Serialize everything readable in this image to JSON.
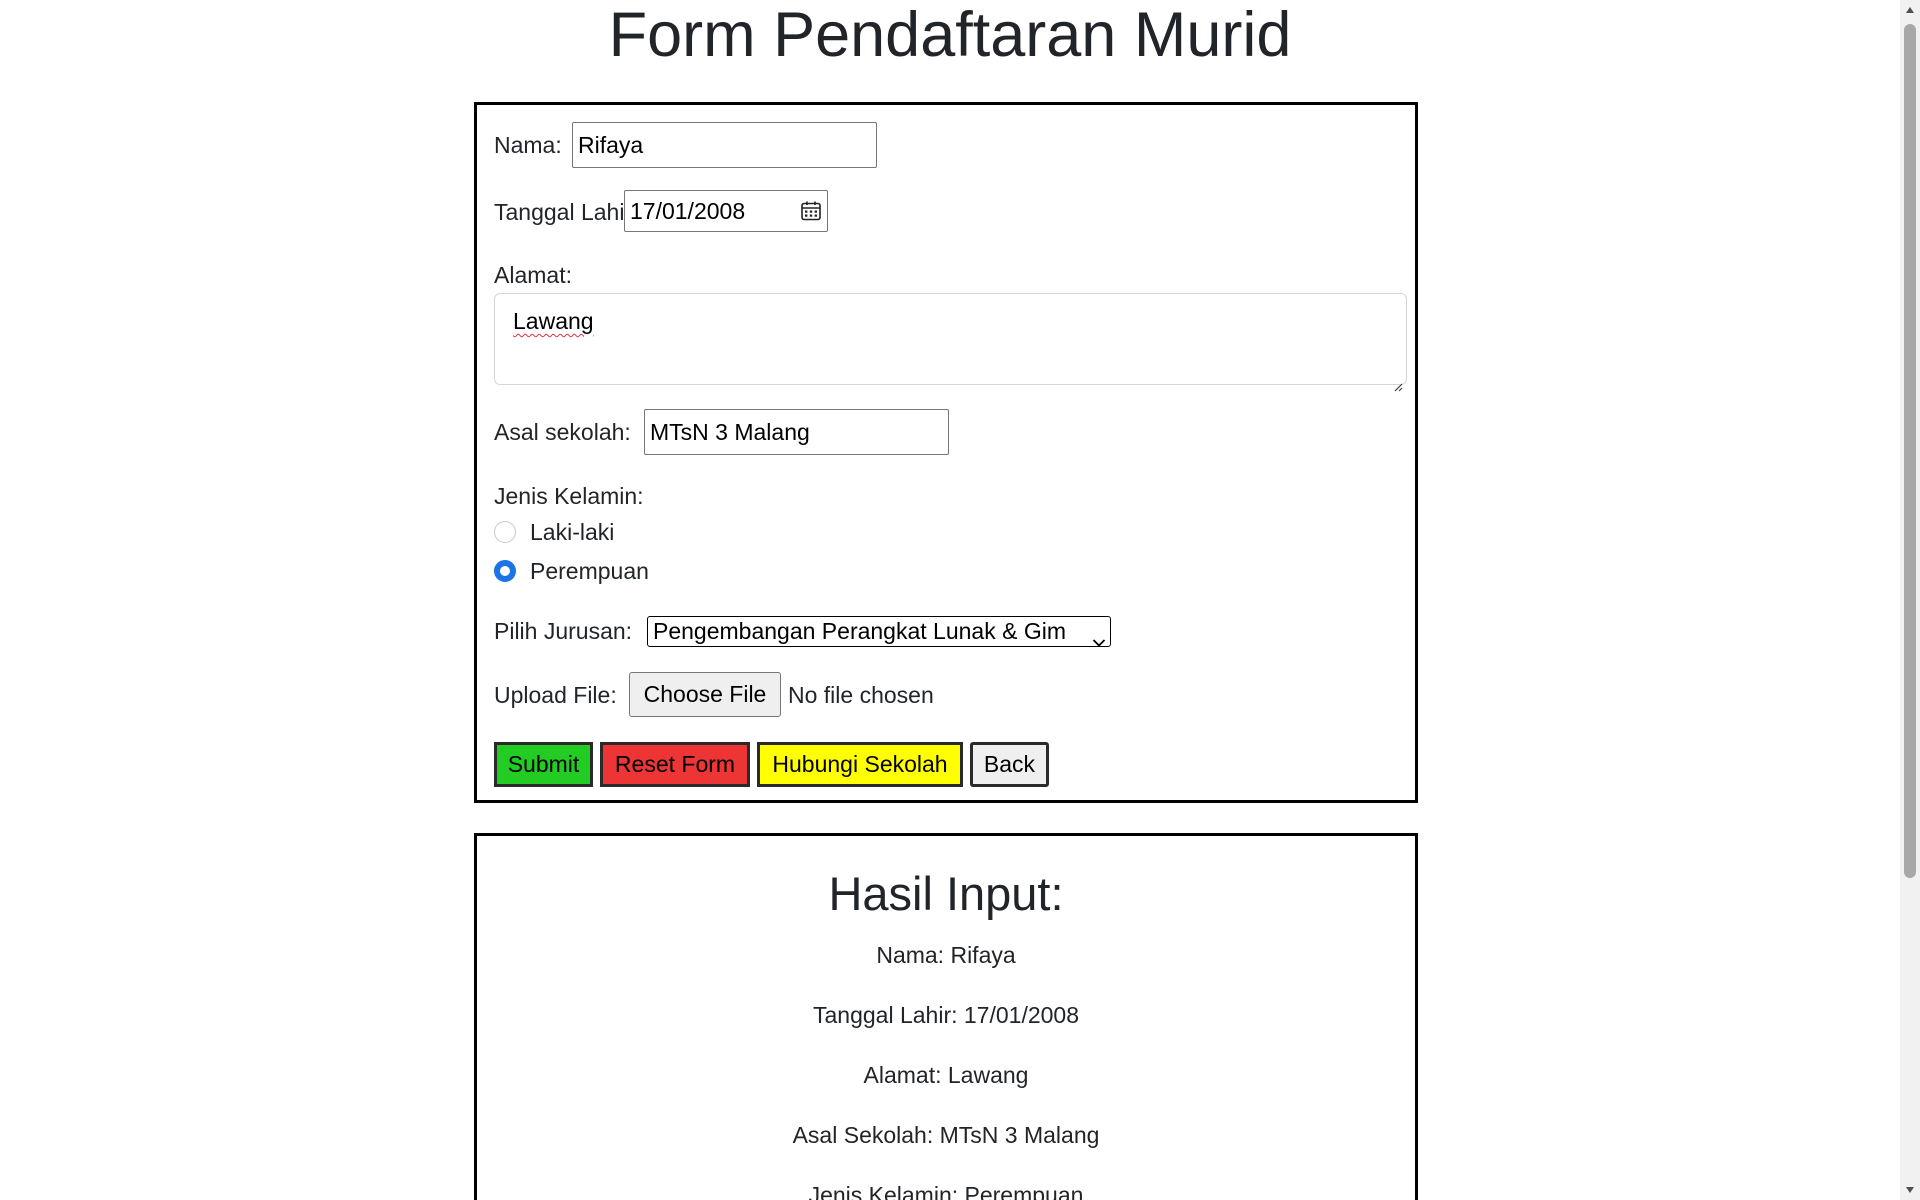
{
  "page": {
    "title": "Form Pendaftaran Murid"
  },
  "form": {
    "nama": {
      "label": "Nama:",
      "value": "Rifaya"
    },
    "tanggal_lahir": {
      "label": "Tanggal Lahir:",
      "value": "17/01/2008",
      "icon": "calendar-icon"
    },
    "alamat": {
      "label": "Alamat:",
      "value": "Lawang"
    },
    "asal_sekolah": {
      "label": "Asal sekolah:",
      "value": "MTsN 3 Malang"
    },
    "jenis_kelamin": {
      "label": "Jenis Kelamin:",
      "options": [
        {
          "label": "Laki-laki",
          "checked": false
        },
        {
          "label": "Perempuan",
          "checked": true
        }
      ]
    },
    "jurusan": {
      "label": "Pilih Jurusan:",
      "selected": "Pengembangan Perangkat Lunak & Gim",
      "icon": "chevron-down-icon"
    },
    "upload": {
      "label": "Upload File:",
      "button": "Choose File",
      "status": "No file chosen"
    },
    "buttons": {
      "submit": "Submit",
      "reset": "Reset Form",
      "contact": "Hubungi Sekolah",
      "back": "Back"
    },
    "colors": {
      "submit": "#22cc22",
      "reset": "#ee3535",
      "contact": "#ffff00",
      "radio_accent": "#1a73e8"
    }
  },
  "result": {
    "title": "Hasil Input:",
    "lines": [
      "Nama: Rifaya",
      "Tanggal Lahir: 17/01/2008",
      "Alamat: Lawang",
      "Asal Sekolah: MTsN 3 Malang",
      "Jenis Kelamin: Perempuan"
    ]
  }
}
